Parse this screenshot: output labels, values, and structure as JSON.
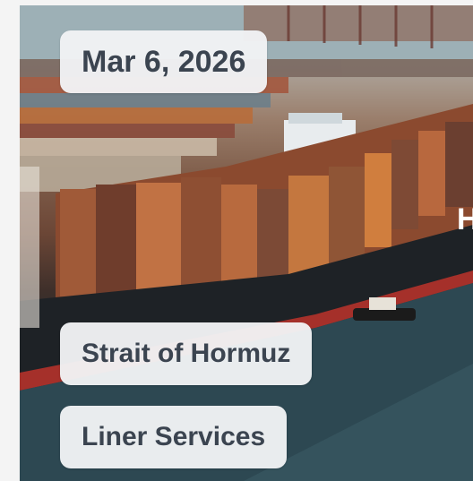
{
  "card": {
    "date": "Mar 6, 2026",
    "tags": [
      "Strait of Hormuz",
      "Liner Services"
    ]
  },
  "image": {
    "subject": "container-ship-at-port-photo",
    "hull_lettering": "H"
  }
}
